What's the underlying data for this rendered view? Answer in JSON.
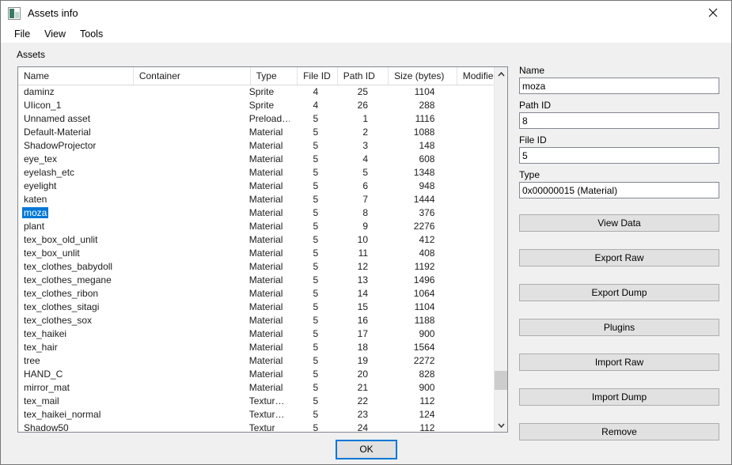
{
  "window": {
    "title": "Assets info",
    "icon": "assets-image-icon",
    "close_label": "✕"
  },
  "menubar": {
    "items": [
      {
        "label": "File"
      },
      {
        "label": "View"
      },
      {
        "label": "Tools"
      }
    ]
  },
  "assets_section": {
    "label": "Assets"
  },
  "list": {
    "columns": [
      {
        "key": "name",
        "label": "Name"
      },
      {
        "key": "container",
        "label": "Container"
      },
      {
        "key": "type",
        "label": "Type"
      },
      {
        "key": "file_id",
        "label": "File ID"
      },
      {
        "key": "path_id",
        "label": "Path ID"
      },
      {
        "key": "size",
        "label": "Size (bytes)"
      },
      {
        "key": "modified",
        "label": "Modified"
      }
    ],
    "selected_row_index": 9,
    "selection_color": "#0078d7",
    "rows": [
      {
        "name": "daminz",
        "container": "",
        "type": "Sprite",
        "file_id": "4",
        "path_id": "25",
        "size": "1104",
        "modified": ""
      },
      {
        "name": "UIicon_1",
        "container": "",
        "type": "Sprite",
        "file_id": "4",
        "path_id": "26",
        "size": "288",
        "modified": ""
      },
      {
        "name": "Unnamed asset",
        "container": "",
        "type": "Preload…",
        "file_id": "5",
        "path_id": "1",
        "size": "1116",
        "modified": ""
      },
      {
        "name": "Default-Material",
        "container": "",
        "type": "Material",
        "file_id": "5",
        "path_id": "2",
        "size": "1088",
        "modified": ""
      },
      {
        "name": "ShadowProjector",
        "container": "",
        "type": "Material",
        "file_id": "5",
        "path_id": "3",
        "size": "148",
        "modified": ""
      },
      {
        "name": "eye_tex",
        "container": "",
        "type": "Material",
        "file_id": "5",
        "path_id": "4",
        "size": "608",
        "modified": ""
      },
      {
        "name": "eyelash_etc",
        "container": "",
        "type": "Material",
        "file_id": "5",
        "path_id": "5",
        "size": "1348",
        "modified": ""
      },
      {
        "name": "eyelight",
        "container": "",
        "type": "Material",
        "file_id": "5",
        "path_id": "6",
        "size": "948",
        "modified": ""
      },
      {
        "name": "katen",
        "container": "",
        "type": "Material",
        "file_id": "5",
        "path_id": "7",
        "size": "1444",
        "modified": ""
      },
      {
        "name": "moza",
        "container": "",
        "type": "Material",
        "file_id": "5",
        "path_id": "8",
        "size": "376",
        "modified": ""
      },
      {
        "name": "plant",
        "container": "",
        "type": "Material",
        "file_id": "5",
        "path_id": "9",
        "size": "2276",
        "modified": ""
      },
      {
        "name": "tex_box_old_unlit",
        "container": "",
        "type": "Material",
        "file_id": "5",
        "path_id": "10",
        "size": "412",
        "modified": ""
      },
      {
        "name": "tex_box_unlit",
        "container": "",
        "type": "Material",
        "file_id": "5",
        "path_id": "11",
        "size": "408",
        "modified": ""
      },
      {
        "name": "tex_clothes_babydoll",
        "container": "",
        "type": "Material",
        "file_id": "5",
        "path_id": "12",
        "size": "1192",
        "modified": ""
      },
      {
        "name": "tex_clothes_megane",
        "container": "",
        "type": "Material",
        "file_id": "5",
        "path_id": "13",
        "size": "1496",
        "modified": ""
      },
      {
        "name": "tex_clothes_ribon",
        "container": "",
        "type": "Material",
        "file_id": "5",
        "path_id": "14",
        "size": "1064",
        "modified": ""
      },
      {
        "name": "tex_clothes_sitagi",
        "container": "",
        "type": "Material",
        "file_id": "5",
        "path_id": "15",
        "size": "1104",
        "modified": ""
      },
      {
        "name": "tex_clothes_sox",
        "container": "",
        "type": "Material",
        "file_id": "5",
        "path_id": "16",
        "size": "1188",
        "modified": ""
      },
      {
        "name": "tex_haikei",
        "container": "",
        "type": "Material",
        "file_id": "5",
        "path_id": "17",
        "size": "900",
        "modified": ""
      },
      {
        "name": "tex_hair",
        "container": "",
        "type": "Material",
        "file_id": "5",
        "path_id": "18",
        "size": "1564",
        "modified": ""
      },
      {
        "name": "tree",
        "container": "",
        "type": "Material",
        "file_id": "5",
        "path_id": "19",
        "size": "2272",
        "modified": ""
      },
      {
        "name": "HAND_C",
        "container": "",
        "type": "Material",
        "file_id": "5",
        "path_id": "20",
        "size": "828",
        "modified": ""
      },
      {
        "name": "mirror_mat",
        "container": "",
        "type": "Material",
        "file_id": "5",
        "path_id": "21",
        "size": "900",
        "modified": ""
      },
      {
        "name": "tex_mail",
        "container": "",
        "type": "Textur…",
        "file_id": "5",
        "path_id": "22",
        "size": "112",
        "modified": ""
      },
      {
        "name": "tex_haikei_normal",
        "container": "",
        "type": "Textur…",
        "file_id": "5",
        "path_id": "23",
        "size": "124",
        "modified": ""
      },
      {
        "name": "Shadow50",
        "container": "",
        "type": "Textur",
        "file_id": "5",
        "path_id": "24",
        "size": "112",
        "modified": ""
      }
    ]
  },
  "scrollbar": {
    "up_arrow": "⌃",
    "down_arrow": "⌄"
  },
  "details": {
    "fields": [
      {
        "label": "Name",
        "value": "moza"
      },
      {
        "label": "Path ID",
        "value": "8"
      },
      {
        "label": "File ID",
        "value": "5"
      },
      {
        "label": "Type",
        "value": "0x00000015 (Material)"
      }
    ],
    "buttons": [
      {
        "label": "View Data"
      },
      {
        "label": "Export Raw"
      },
      {
        "label": "Export Dump"
      },
      {
        "label": "Plugins"
      },
      {
        "label": "Import Raw"
      },
      {
        "label": "Import Dump"
      },
      {
        "label": "Remove"
      }
    ]
  },
  "footer": {
    "ok_label": "OK"
  }
}
